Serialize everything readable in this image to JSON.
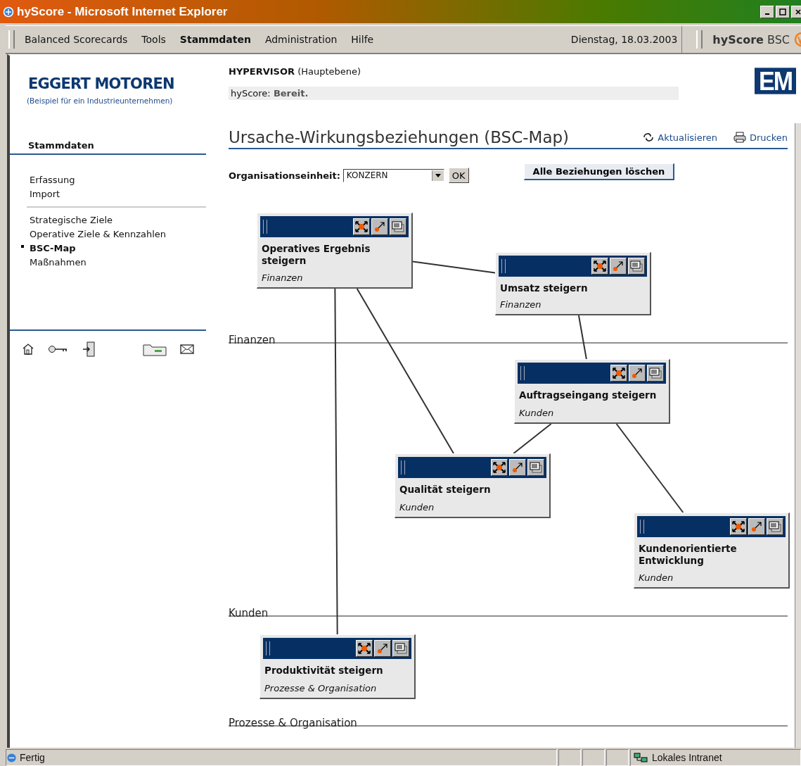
{
  "window": {
    "title": "hyScore - Microsoft Internet Explorer"
  },
  "menu": [
    {
      "label": "Balanced Scorecards",
      "selected": false
    },
    {
      "label": "Tools",
      "selected": false
    },
    {
      "label": "Stammdaten",
      "selected": true
    },
    {
      "label": "Administration",
      "selected": false
    },
    {
      "label": "Hilfe",
      "selected": false
    }
  ],
  "date": "Dienstag, 18.03.2003",
  "brand": {
    "bold": "hyScore",
    "light": "BSC"
  },
  "company": {
    "name": "EGGERT MOTOREN",
    "subtitle": "(Beispiel für ein Industrieunternehmen)",
    "logo_mark": "EM"
  },
  "user": "**HYPERVISOR** (Hauptebene)",
  "status_field": {
    "label": "hyScore:",
    "value": "Bereit."
  },
  "sidebar": {
    "heading": "Stammdaten",
    "groups": [
      [
        {
          "label": "Erfassung",
          "selected": false
        },
        {
          "label": "Import",
          "selected": false
        }
      ],
      [
        {
          "label": "Strategische Ziele",
          "selected": false
        },
        {
          "label": "Operative Ziele & Kennzahlen",
          "selected": false
        },
        {
          "label": "BSC-Map",
          "selected": true
        },
        {
          "label": "Maßnahmen",
          "selected": false
        }
      ]
    ]
  },
  "page": {
    "title": "Ursache-Wirkungsbeziehungen (BSC-Map)",
    "actions": [
      {
        "kind": "refresh",
        "label": "Aktualisieren"
      },
      {
        "kind": "print",
        "label": "Drucken"
      }
    ]
  },
  "filter": {
    "label": "Organisationseinheit:",
    "value": "KONZERN",
    "ok": "OK",
    "clear_button": "Alle Beziehungen löschen"
  },
  "lanes": [
    "Finanzen",
    "Kunden",
    "Prozesse & Organisation"
  ],
  "nodes": [
    {
      "title": "Operatives Ergebnis steigern",
      "perspective": "Finanzen"
    },
    {
      "title": "Umsatz steigern",
      "perspective": "Finanzen"
    },
    {
      "title": "Auftragseingang steigern",
      "perspective": "Kunden"
    },
    {
      "title": "Qualität steigern",
      "perspective": "Kunden"
    },
    {
      "title": "Kundenorientierte Entwicklung",
      "perspective": "Kunden"
    },
    {
      "title": "Produktivität steigern",
      "perspective": "Prozesse & Organisation"
    }
  ],
  "status_bar": {
    "text": "Fertig",
    "zone": "Lokales Intranet"
  }
}
